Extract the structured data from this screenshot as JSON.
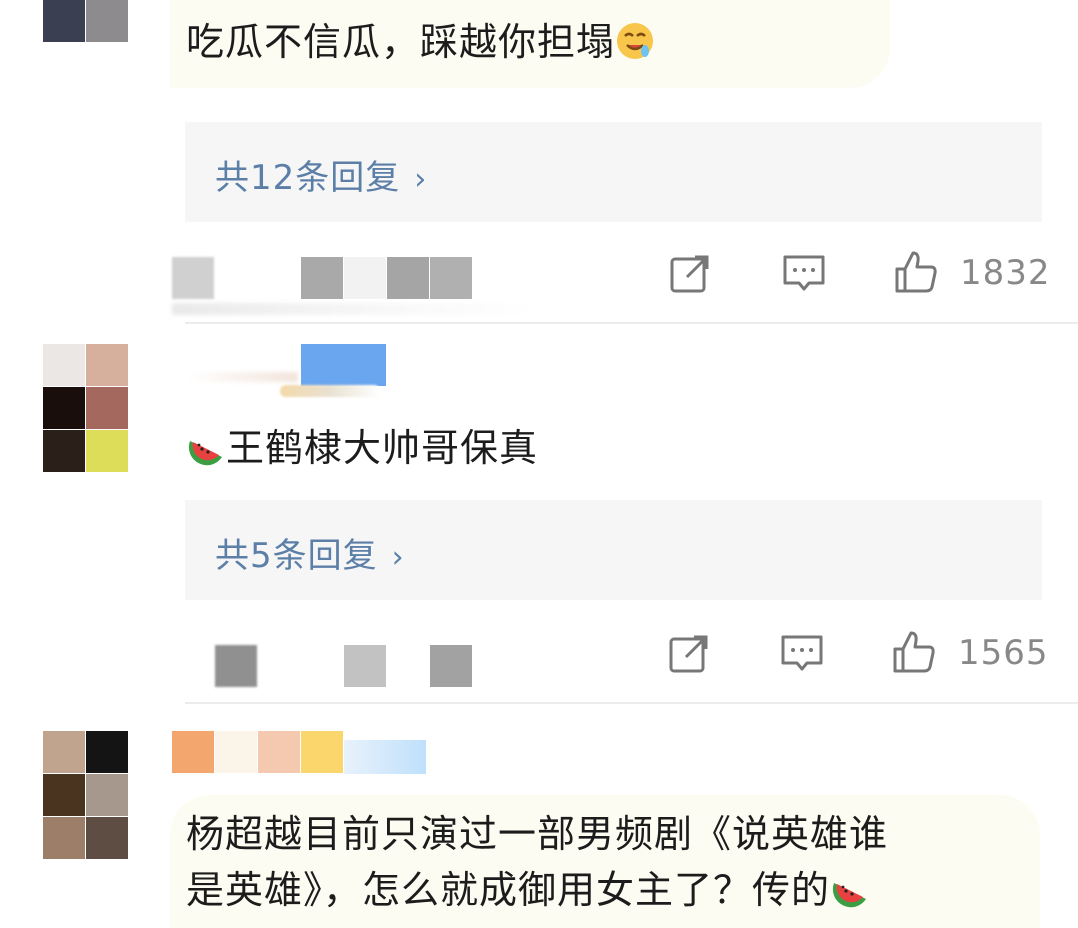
{
  "comments": [
    {
      "text": "吃瓜不信瓜，踩越你担塌",
      "emoji": "drooling-face-emoji",
      "reply_label": "共12条回复",
      "like_count": "1832"
    },
    {
      "emoji_prefix": "watermelon-emoji",
      "text": "王鹤棣大帅哥保真",
      "reply_label": "共5条回复",
      "like_count": "1565"
    },
    {
      "text_line1": "杨超越目前只演过一部男频剧《说英雄谁",
      "text_line2": "是英雄》，怎么就成御用女主了？传的",
      "emoji": "watermelon-emoji"
    }
  ],
  "icons": {
    "share": "share-icon",
    "comment": "comment-icon",
    "like": "thumbs-up-icon",
    "chevron": "chevron-right-icon"
  },
  "colors": {
    "link": "#5c7fa8",
    "reply_bg": "#f6f6f6",
    "meta": "#888888"
  },
  "chevron_glyph": "›"
}
